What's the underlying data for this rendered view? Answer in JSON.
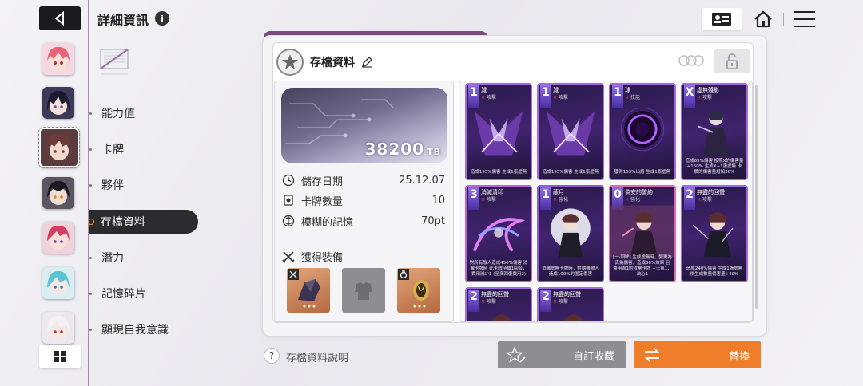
{
  "header": {
    "title": "詳細資訊",
    "info_symbol": "i"
  },
  "nav": {
    "items": [
      {
        "label": "能力值",
        "active": false
      },
      {
        "label": "卡牌",
        "active": false
      },
      {
        "label": "夥伴",
        "active": false
      },
      {
        "label": "存檔資料",
        "active": true
      },
      {
        "label": "潛力",
        "active": false
      },
      {
        "label": "記憶碎片",
        "active": false
      },
      {
        "label": "顯現自我意識",
        "active": false
      }
    ]
  },
  "panel": {
    "title": "存檔資料",
    "storage": {
      "value": "38200",
      "unit": "TB"
    },
    "stats": [
      {
        "icon": "clock-icon",
        "label": "儲存日期",
        "value": "25.12.07"
      },
      {
        "icon": "card-count-icon",
        "label": "卡牌數量",
        "value": "10"
      },
      {
        "icon": "memory-icon",
        "label": "模糊的記憶",
        "value": "70pt"
      }
    ],
    "equipment_title": "獲得裝備",
    "cards": [
      {
        "cost": "1",
        "name": "減",
        "type_mark": "✕",
        "type": "攻擊",
        "desc": "造成153%傷害 生成1張虛無",
        "color": "#a46be0",
        "art": "glass"
      },
      {
        "cost": "1",
        "name": "減",
        "type_mark": "✕",
        "type": "攻擊",
        "desc": "造成153%傷害 生成1張虛無",
        "color": "#a46be0",
        "art": "glass"
      },
      {
        "cost": "1",
        "name": "球",
        "type_mark": "✕",
        "type": "技能",
        "desc": "獲得153%出盾 生成1張虛無",
        "color": "#a46be0",
        "art": "orb"
      },
      {
        "cost": "X",
        "name": "虛無殘影",
        "type_mark": "✕",
        "type": "攻擊",
        "desc": "造成65%傷害 按照X的傷害量+150% 生成X+1張虛無 卡牌的傷害量增加30%",
        "color": "#a46be0",
        "art": "figure"
      },
      {
        "cost": "3",
        "name": "消滅清印",
        "type_mark": "✕",
        "type": "攻擊",
        "desc": "對所有敵人造成450%傷害 消滅卡牌時 此卡牌持續1回合，費用減少1 (至多回復費用2)",
        "color": "#c060d8",
        "art": "swirl"
      },
      {
        "cost": "1",
        "name": "蔽月",
        "type_mark": "✕",
        "type": "強化",
        "desc": "消滅虛無卡牌時，對隨機敵人造成100%的固定傷害",
        "color": "#8a5cc8",
        "art": "figure2"
      },
      {
        "cost": "0",
        "name": "偽安的誓約",
        "type_mark": "✕",
        "type": "強化",
        "desc": "[一·回眸] 生成虛無時，變更為真偽傷害，造成80%效果 且費用為1的攻擊卡牌 +士氣1、決心1",
        "color": "#e06ab0",
        "art": "figure3"
      },
      {
        "cost": "2",
        "name": "無盡的回聲",
        "type_mark": "✕",
        "type": "攻擊",
        "desc": "造成240%傷害 生成1張虛無 依生成數量傷害量+40%",
        "color": "#a46be0",
        "art": "figure4"
      },
      {
        "cost": "2",
        "name": "無盡的回聲",
        "type_mark": "✕",
        "type": "攻擊",
        "desc": "",
        "color": "#a46be0",
        "art": "figure4"
      },
      {
        "cost": "2",
        "name": "無盡的回聲",
        "type_mark": "✕",
        "type": "攻擊",
        "desc": "",
        "color": "#a46be0",
        "art": "figure4"
      }
    ]
  },
  "footer": {
    "help_label": "存檔資料說明",
    "help_symbol": "?",
    "collect_label": "自訂收藏",
    "replace_label": "替換"
  }
}
